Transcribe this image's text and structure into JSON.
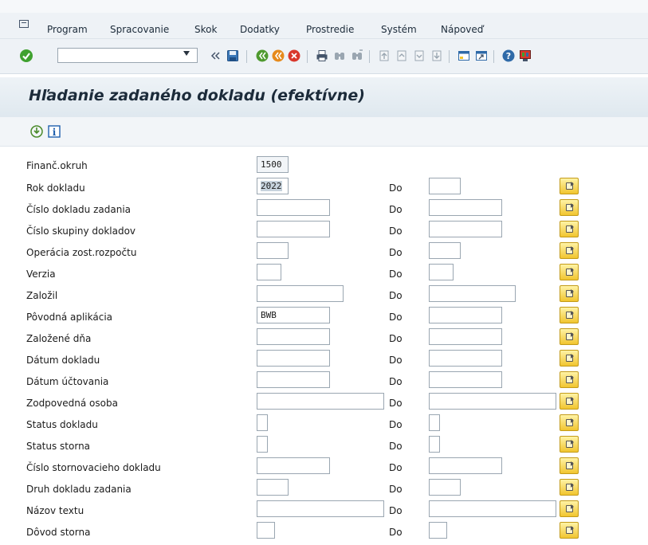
{
  "menubar": {
    "items": [
      "Program",
      "Spracovanie",
      "Skok",
      "Dodatky",
      "Prostredie",
      "Systém",
      "Nápoveď"
    ]
  },
  "toolbar": {
    "command_value": "",
    "icons": [
      "enter-check-icon",
      "command-dropdown-icon",
      "collapse-icon",
      "save-icon",
      "back-icon",
      "exit-icon",
      "cancel-icon",
      "print-icon",
      "find-icon",
      "find-next-icon",
      "first-page-icon",
      "previous-page-icon",
      "next-page-icon",
      "last-page-icon",
      "new-session-icon",
      "shortcut-icon",
      "help-icon",
      "customize-layout-icon"
    ]
  },
  "title": "Hľadanie zadaného dokladu (efektívne)",
  "app_toolbar": {
    "icons": [
      "execute-icon",
      "info-icon"
    ]
  },
  "form": {
    "do_label": "Do",
    "rows": [
      {
        "label": "Finanč.okruh",
        "from_value": "1500",
        "to_value": ""
      },
      {
        "label": "Rok dokladu",
        "from_value": "2022",
        "to_value": ""
      },
      {
        "label": "Číslo dokladu zadania",
        "from_value": "",
        "to_value": ""
      },
      {
        "label": "Číslo skupiny dokladov",
        "from_value": "",
        "to_value": ""
      },
      {
        "label": "Operácia zost.rozpočtu",
        "from_value": "",
        "to_value": ""
      },
      {
        "label": "Verzia",
        "from_value": "",
        "to_value": ""
      },
      {
        "label": "Založil",
        "from_value": "",
        "to_value": ""
      },
      {
        "label": "Pôvodná aplikácia",
        "from_value": "BWB",
        "to_value": ""
      },
      {
        "label": "Založené dňa",
        "from_value": "",
        "to_value": ""
      },
      {
        "label": "Dátum dokladu",
        "from_value": "",
        "to_value": ""
      },
      {
        "label": "Dátum účtovania",
        "from_value": "",
        "to_value": ""
      },
      {
        "label": "Zodpovedná osoba",
        "from_value": "",
        "to_value": ""
      },
      {
        "label": "Status dokladu",
        "from_value": "",
        "to_value": ""
      },
      {
        "label": "Status storna",
        "from_value": "",
        "to_value": ""
      },
      {
        "label": "Číslo stornovacieho dokladu",
        "from_value": "",
        "to_value": ""
      },
      {
        "label": "Druh dokladu zadania",
        "from_value": "",
        "to_value": ""
      },
      {
        "label": "Názov textu",
        "from_value": "",
        "to_value": ""
      },
      {
        "label": "Dôvod storna",
        "from_value": "",
        "to_value": ""
      }
    ]
  },
  "colors": {
    "menubar_bg": "#eef2f6",
    "title_text": "#1c2b3a",
    "multiple_selection_button": "#f1c52f",
    "enter_check": "#3fa12f",
    "execute_icon": "#4a8a2a",
    "info_icon": "#1f5fae"
  }
}
